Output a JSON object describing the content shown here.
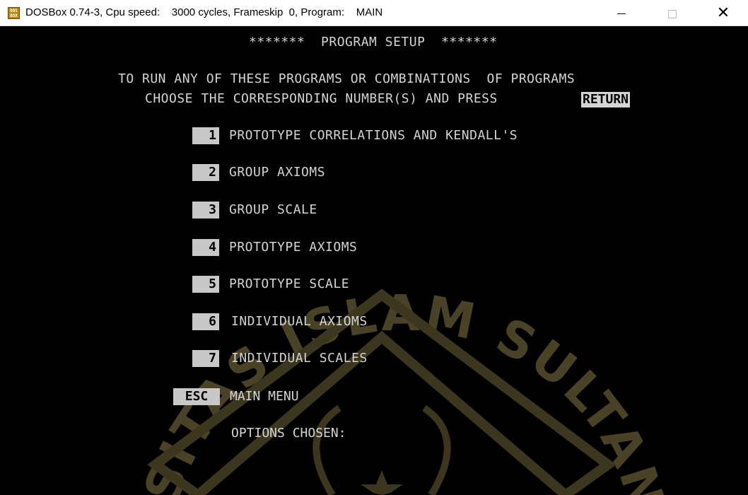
{
  "window": {
    "title": "DOSBox 0.74-3, Cpu speed:    3000 cycles, Frameskip  0, Program:    MAIN",
    "icon": "dosbox-icon",
    "icon_text": "DOS BOX",
    "minimize_icon": "minimize-icon",
    "maximize_icon": "maximize-icon",
    "close_icon": "close-icon"
  },
  "screen": {
    "header": "*******  PROGRAM SETUP  *******",
    "instruction_line1": "TO RUN ANY OF THESE PROGRAMS OR COMBINATIONS  OF PROGRAMS",
    "instruction_line2": "CHOOSE THE CORRESPONDING NUMBER(S) AND PRESS",
    "return_key": "RETURN",
    "menu_items": [
      {
        "key": "1",
        "label": "PROTOTYPE CORRELATIONS AND KENDALL'S"
      },
      {
        "key": "2",
        "label": "GROUP AXIOMS"
      },
      {
        "key": "3",
        "label": "GROUP SCALE"
      },
      {
        "key": "4",
        "label": "PROTOTYPE AXIOMS"
      },
      {
        "key": "5",
        "label": "PROTOTYPE SCALE"
      },
      {
        "key": "6",
        "label": "INDIVIDUAL AXIOMS"
      },
      {
        "key": "7",
        "label": "INDIVIDUAL SCALES"
      }
    ],
    "esc_key": "ESC",
    "esc_label": "MAIN MENU",
    "options_chosen": "OPTIONS CHOSEN:",
    "watermark_text": "SITAS ISLAM SULTAN"
  },
  "colors": {
    "screen_bg": "#000000",
    "text": "#d4d4d4",
    "key_box_bg": "#c8c8c8",
    "watermark": "#4a4226"
  }
}
